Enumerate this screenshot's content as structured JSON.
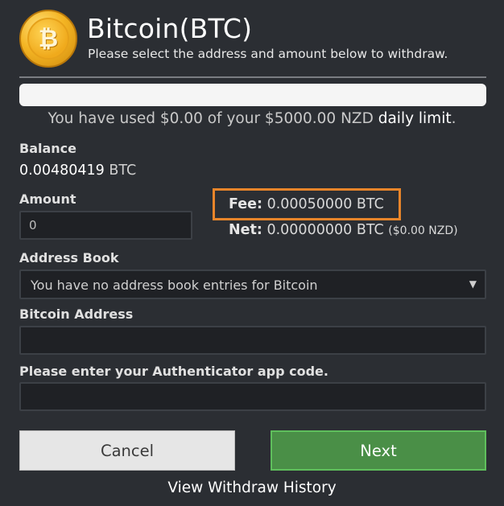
{
  "header": {
    "title": "Bitcoin(BTC)",
    "subtitle": "Please select the address and amount below to withdraw.",
    "logo_icon": "bitcoin-logo-icon",
    "logo_glyph": "₿"
  },
  "limit": {
    "used_fraction": 0,
    "text_prefix": "You have used $0.00 of your $5000.00 NZD ",
    "link_text": "daily limit",
    "text_suffix": "."
  },
  "balance": {
    "label": "Balance",
    "amount": "0.00480419",
    "unit": "BTC"
  },
  "amount": {
    "label": "Amount",
    "value": "0"
  },
  "fee": {
    "label": "Fee:",
    "amount": "0.00050000",
    "unit": "BTC"
  },
  "net": {
    "label": "Net:",
    "amount": "0.00000000",
    "unit": "BTC",
    "fiat": "($0.00 NZD)"
  },
  "address_book": {
    "label": "Address Book",
    "selected": "You have no address book entries for Bitcoin",
    "arrow_icon": "caret-down-icon",
    "arrow_glyph": "▼"
  },
  "bitcoin_address": {
    "label": "Bitcoin Address",
    "value": ""
  },
  "auth_code": {
    "label": "Please enter your Authenticator app code.",
    "value": ""
  },
  "buttons": {
    "cancel": "Cancel",
    "next": "Next"
  },
  "history_link": "View Withdraw History",
  "colors": {
    "background": "#2b2e33",
    "fee_highlight": "#e8852a",
    "next_button": "#4a8f47",
    "cancel_button": "#e6e6e6"
  }
}
